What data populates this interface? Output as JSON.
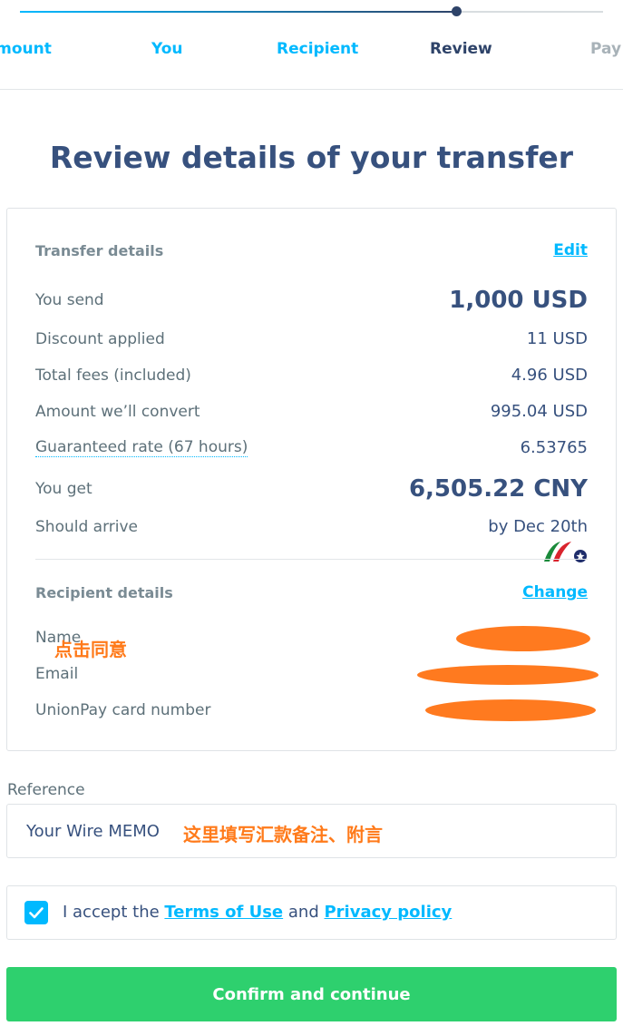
{
  "stepper": {
    "steps": [
      {
        "label": "Amount",
        "state": "done"
      },
      {
        "label": "You",
        "state": "done"
      },
      {
        "label": "Recipient",
        "state": "done"
      },
      {
        "label": "Review",
        "state": "current"
      },
      {
        "label": "Pay",
        "state": "todo"
      }
    ],
    "progress_percent": 75
  },
  "page": {
    "title": "Review details of your transfer"
  },
  "transfer": {
    "heading": "Transfer details",
    "edit_label": "Edit",
    "rows": [
      {
        "label": "You send",
        "value": "1,000 USD"
      },
      {
        "label": "Discount applied",
        "value": "11 USD"
      },
      {
        "label": "Total fees (included)",
        "value": "4.96 USD"
      },
      {
        "label": "Amount we’ll convert",
        "value": "995.04 USD"
      },
      {
        "label": "Guaranteed rate (67 hours)",
        "value": "6.53765"
      },
      {
        "label": "You get",
        "value": "6,505.22 CNY"
      },
      {
        "label": "Should arrive",
        "value": "by Dec 20th"
      }
    ]
  },
  "recipient": {
    "heading": "Recipient details",
    "change_label": "Change",
    "rows": [
      {
        "label": "Name"
      },
      {
        "label": "Email"
      },
      {
        "label": "UnionPay card number"
      }
    ]
  },
  "annotations": {
    "click_agree": "点击同意",
    "reference_note": "这里填写汇款备注、附言"
  },
  "reference": {
    "label": "Reference",
    "value": "Your Wire MEMO"
  },
  "terms": {
    "checked": true,
    "prefix": "I accept the",
    "terms_link": "Terms of Use",
    "conjunction": "and",
    "privacy_link": "Privacy policy"
  },
  "confirm_button": {
    "label": "Confirm and continue"
  },
  "colors": {
    "accent": "#00b9ff",
    "navy": "#37517e",
    "success": "#2ed06e",
    "annotation": "#ff7a1a"
  }
}
